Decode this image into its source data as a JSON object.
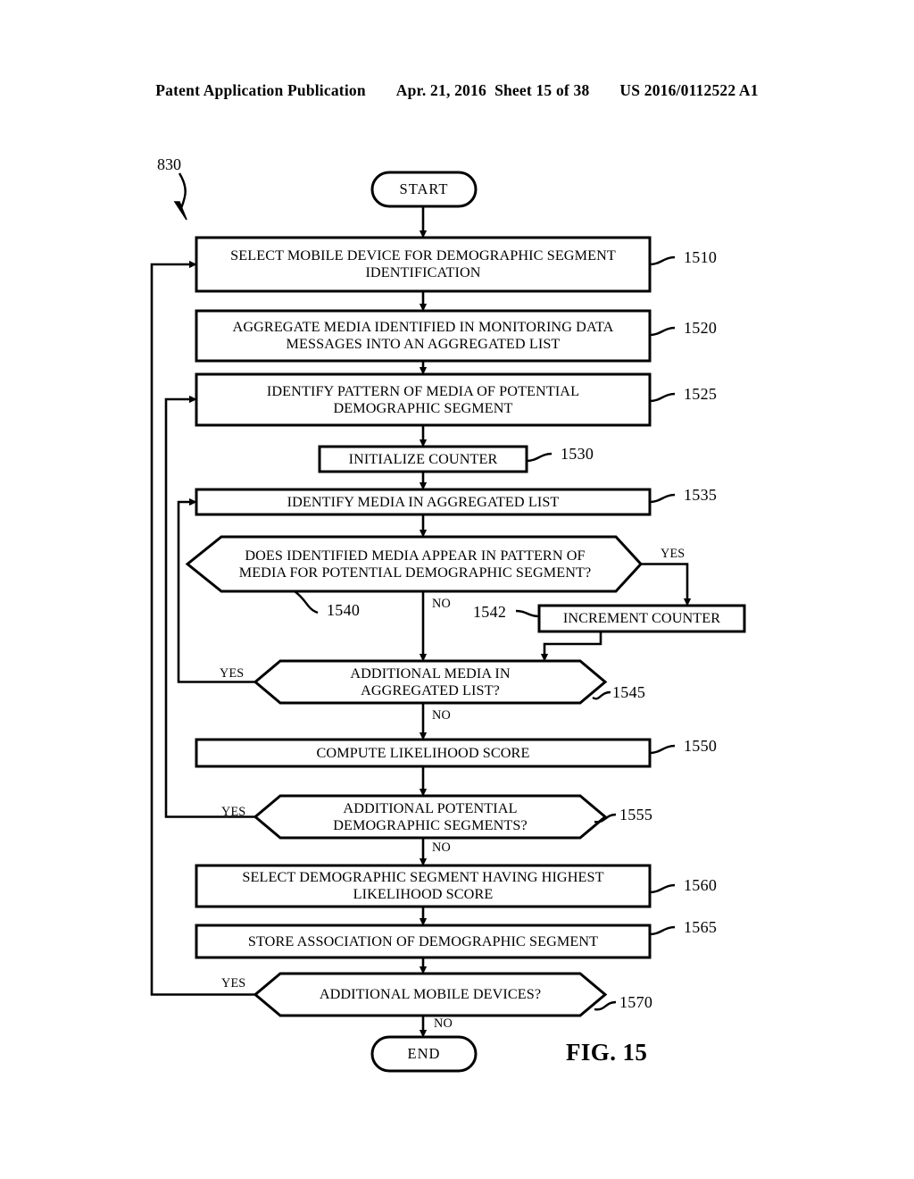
{
  "header": {
    "publication": "Patent Application Publication",
    "date": "Apr. 21, 2016",
    "sheet": "Sheet 15 of 38",
    "docnum": "US 2016/0112522 A1"
  },
  "figure": {
    "label": "FIG. 15",
    "flow_ref": "830"
  },
  "terminals": {
    "start": "START",
    "end": "END"
  },
  "nodes": [
    {
      "id": "1510",
      "ref": "1510",
      "shape": "process",
      "text": "SELECT MOBILE DEVICE FOR DEMOGRAPHIC SEGMENT\nIDENTIFICATION"
    },
    {
      "id": "1520",
      "ref": "1520",
      "shape": "process",
      "text": "AGGREGATE MEDIA IDENTIFIED IN MONITORING DATA\nMESSAGES INTO AN AGGREGATED LIST"
    },
    {
      "id": "1525",
      "ref": "1525",
      "shape": "process",
      "text": "IDENTIFY PATTERN OF MEDIA  OF POTENTIAL\nDEMOGRAPHIC SEGMENT"
    },
    {
      "id": "1530",
      "ref": "1530",
      "shape": "process",
      "text": "INITIALIZE COUNTER"
    },
    {
      "id": "1535",
      "ref": "1535",
      "shape": "process",
      "text": "IDENTIFY MEDIA IN AGGREGATED LIST"
    },
    {
      "id": "1540",
      "ref": "1540",
      "shape": "decision",
      "text": "DOES IDENTIFIED MEDIA APPEAR IN PATTERN OF\nMEDIA FOR POTENTIAL DEMOGRAPHIC SEGMENT?"
    },
    {
      "id": "1542",
      "ref": "1542",
      "shape": "process",
      "text": "INCREMENT COUNTER"
    },
    {
      "id": "1545",
      "ref": "1545",
      "shape": "decision",
      "text": "ADDITIONAL MEDIA IN\nAGGREGATED LIST?"
    },
    {
      "id": "1550",
      "ref": "1550",
      "shape": "process",
      "text": "COMPUTE LIKELIHOOD SCORE"
    },
    {
      "id": "1555",
      "ref": "1555",
      "shape": "decision",
      "text": "ADDITIONAL POTENTIAL\nDEMOGRAPHIC SEGMENTS?"
    },
    {
      "id": "1560",
      "ref": "1560",
      "shape": "process",
      "text": "SELECT DEMOGRAPHIC SEGMENT HAVING HIGHEST\nLIKELIHOOD SCORE"
    },
    {
      "id": "1565",
      "ref": "1565",
      "shape": "process",
      "text": "STORE ASSOCIATION OF DEMOGRAPHIC SEGMENT"
    },
    {
      "id": "1570",
      "ref": "1570",
      "shape": "decision",
      "text": "ADDITIONAL MOBILE DEVICES?"
    }
  ],
  "branch_labels": {
    "d1540_yes": "YES",
    "d1540_no": "NO",
    "d1545_yes": "YES",
    "d1545_no": "NO",
    "d1555_yes": "YES",
    "d1555_no": "NO",
    "d1570_yes": "YES",
    "d1570_no": "NO"
  },
  "colors": {
    "ink": "#000000",
    "paper": "#ffffff"
  }
}
